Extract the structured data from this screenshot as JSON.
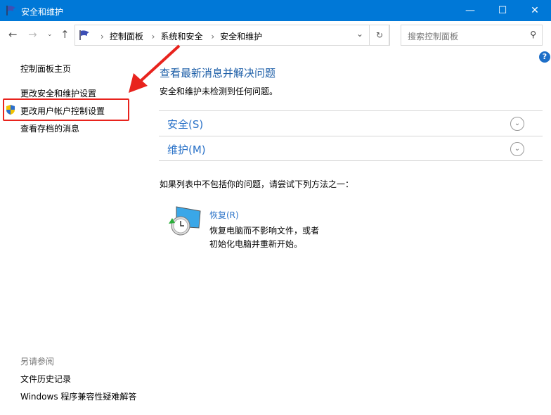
{
  "window": {
    "title": "安全和维护",
    "accent": "#0078d7"
  },
  "address": {
    "crumbs": [
      "控制面板",
      "系统和安全",
      "安全和维护"
    ]
  },
  "search": {
    "placeholder": "搜索控制面板"
  },
  "sidebar": {
    "items": [
      "控制面板主页",
      "更改安全和维护设置",
      "更改用户帐户控制设置",
      "查看存档的消息"
    ],
    "see_also_label": "另请参阅",
    "see_also": [
      "文件历史记录",
      "Windows 程序兼容性疑难解答"
    ]
  },
  "main": {
    "title": "查看最新消息并解决问题",
    "status": "安全和维护未检测到任何问题。",
    "sections": [
      "安全(S)",
      "维护(M)"
    ],
    "hint": "如果列表中不包括你的问题，请尝试下列方法之一：",
    "recovery": {
      "title": "恢复(R)",
      "desc1": "恢复电脑而不影响文件，或者",
      "desc2": "初始化电脑并重新开始。"
    }
  },
  "annotation": {
    "highlight_color": "#e8231d"
  }
}
